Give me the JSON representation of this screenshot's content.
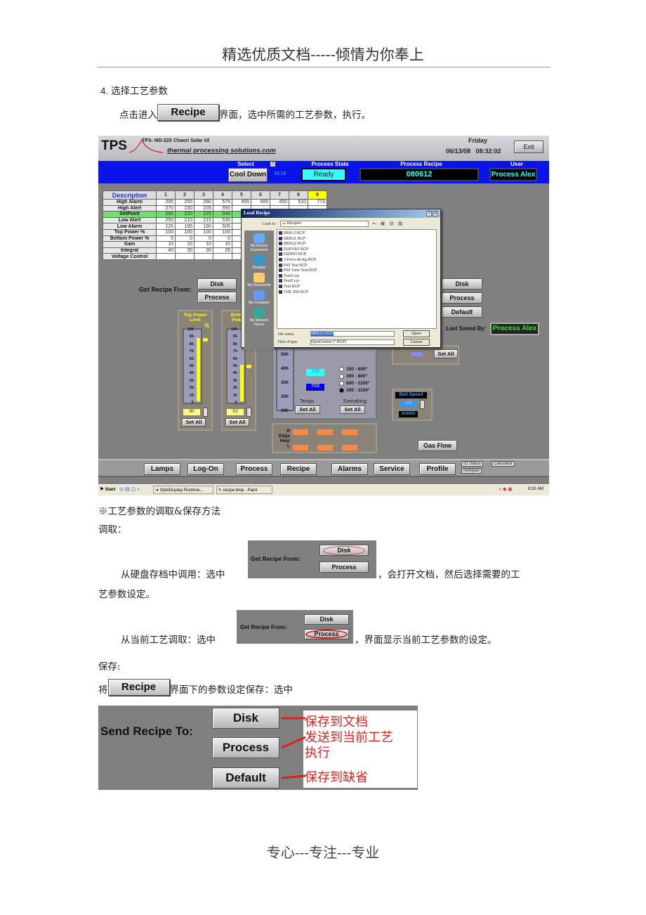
{
  "doc": {
    "header": "精选优质文档-----倾情为你奉上",
    "section_title": "4.  选择工艺参数",
    "intro_prefix": "点击进入",
    "intro_button": "Recipe",
    "intro_suffix": "界面，选中所需的工艺参数，执行。",
    "method_title": "※工艺参数的调取&保存方法",
    "retrieve_label": "调取：",
    "from_disk_prefix": "从硬盘存档中调用：选中",
    "from_disk_suffix": "，会打开文档，然后选择需要的工",
    "from_disk_cont": "艺参数设定。",
    "from_process_prefix": "从当前工艺调取：选中",
    "from_process_suffix": "，界面显示当前工艺参数的设定。",
    "save_label": "保存:",
    "save_prefix": "将",
    "save_button": "Recipe",
    "save_suffix": "界面下的参数设定保存：选中",
    "footer": "专心---专注---专业"
  },
  "get_recipe": {
    "label": "Get Recipe From:",
    "disk": "Disk",
    "process": "Process"
  },
  "send_recipe": {
    "label": "Send Recipe To:",
    "disk": "Disk",
    "process": "Process",
    "default": "Default",
    "notes": [
      "保存到文档",
      "发送到当前工艺",
      "执行",
      "保存到缺省"
    ]
  },
  "app": {
    "logo": "TPS",
    "model": "TPS- MD-225",
    "customer": "Chaori Solar #2",
    "website": "thermal processing solutions.com",
    "day": "Friday",
    "datetime": "06/13/08   08:32:02",
    "exit": "Exit",
    "select_label": "Select",
    "select_value": "Cool Down",
    "timer": "18:16",
    "process_state_label": "Process State",
    "process_state": "Ready",
    "process_recipe_label": "Process Recipe",
    "process_recipe": "080612",
    "user_label": "User",
    "user": "Process Alex",
    "help_icon": "?"
  },
  "table": {
    "columns": [
      "Description",
      "1",
      "2",
      "3",
      "4",
      "5",
      "6",
      "7",
      "8",
      "9"
    ],
    "rows": [
      {
        "label": "High Alarm",
        "values": [
          "295",
          "255",
          "260",
          "575",
          "455",
          "455",
          "450",
          "610",
          "773"
        ]
      },
      {
        "label": "High Alert",
        "values": [
          "270",
          "230",
          "235",
          "550",
          "",
          "",
          "",
          "",
          ""
        ]
      },
      {
        "label": "SetPoint",
        "values": [
          "260",
          "220",
          "225",
          "540",
          "",
          "",
          "",
          "",
          ""
        ]
      },
      {
        "label": "Low Alert",
        "values": [
          "250",
          "210",
          "215",
          "530",
          "",
          "",
          "",
          "",
          ""
        ]
      },
      {
        "label": "Low Alarm",
        "values": [
          "225",
          "185",
          "190",
          "505",
          "",
          "",
          "",
          "",
          ""
        ]
      },
      {
        "label": "Top Power %",
        "values": [
          "100",
          "100",
          "100",
          "100",
          "",
          "",
          "",
          "",
          ""
        ]
      },
      {
        "label": "Bottom Power %",
        "values": [
          "0",
          "0",
          "0",
          "0",
          "",
          "",
          "",
          "",
          ""
        ]
      },
      {
        "label": "Gain",
        "values": [
          "10",
          "10",
          "10",
          "10",
          "",
          "",
          "",
          "",
          ""
        ]
      },
      {
        "label": "Integral",
        "values": [
          "40",
          "30",
          "30",
          "26",
          "",
          "",
          "",
          "",
          ""
        ]
      },
      {
        "label": "Voltage Control",
        "values": [
          "",
          "",
          "",
          "",
          "",
          "",
          "",
          "",
          ""
        ]
      }
    ]
  },
  "dialog": {
    "title": "Load Recipe",
    "look_in_label": "Look in:",
    "look_in": "Recipes",
    "places": [
      "My Recent Documents",
      "Desktop",
      "My Documents",
      "My Computer",
      "My Network Places"
    ],
    "files": [
      "0806-2.RCP",
      "080611.RCP",
      "080612.RCP",
      "DUPONT.RCP",
      "FERRO.RCP",
      "J-Ferro-Al-Ag.RCP",
      "PID Test.RCP",
      "PID Tune Test.RCP",
      "Test2.rcp",
      "Test3.rcp",
      "Test.RCP",
      "TOE 200.RCP"
    ],
    "file_name_label": "File name:",
    "file_name": "080612.RCP",
    "file_type_label": "Files of type:",
    "file_type": "OptoControl (*.RCP)",
    "open": "Open",
    "cancel": "Cancel"
  },
  "top_power": {
    "title": "Top Power Limit",
    "unit": "%",
    "value": "90",
    "level_percent": 90,
    "set_all": "Set All",
    "ticks": [
      "100",
      "90",
      "80",
      "70",
      "60",
      "50",
      "40",
      "30",
      "20",
      "10",
      "0"
    ]
  },
  "bottom_power": {
    "title": "Bottom Power",
    "value": "52",
    "level_percent": 52,
    "set_all": "Set All"
  },
  "temps": {
    "ticks": [
      "500",
      "400",
      "300",
      "200",
      "100"
    ],
    "actual": "728",
    "setpoint": "703",
    "ranges": [
      "100 - 600°",
      "300 - 800°",
      "600 - 1100°",
      "100 - 1100°"
    ],
    "selected_range": "100 - 1100°",
    "temps_label": "Temps",
    "everything_label": "Everything",
    "set_all": "Set All"
  },
  "edge_heat": {
    "label_r": "R",
    "label": "Edge Heat",
    "label_l": "L"
  },
  "belt": {
    "label": "Belt Speed",
    "value": "225",
    "unit": "in/min"
  },
  "gain_set_all": "Set All",
  "send_panel": {
    "disk": "Disk",
    "process": "Process",
    "default": "Default",
    "last_saved_label": "Last Saved By:",
    "last_saved": "Process Alex"
  },
  "gas_flow": "Gas Flow",
  "nav": [
    "Lamps",
    "Log-On",
    "Process",
    "Recipe",
    "Alarms",
    "Service",
    "Profile"
  ],
  "mini": {
    "io_status": "IO Status",
    "notepad": "Notepad",
    "calculator": "Calculator"
  },
  "taskbar": {
    "start": "Start",
    "task1": "OptoDisplay Runtime...",
    "task2": "recipe.bmp - Paint",
    "clock": "8:32 AM"
  },
  "colors": {
    "blue_bar": "#0a14e8",
    "setpoint_row": "#6fe06f",
    "ready": "#33ffff",
    "last_saved": "#22ee22",
    "annotation": "#e02020"
  }
}
